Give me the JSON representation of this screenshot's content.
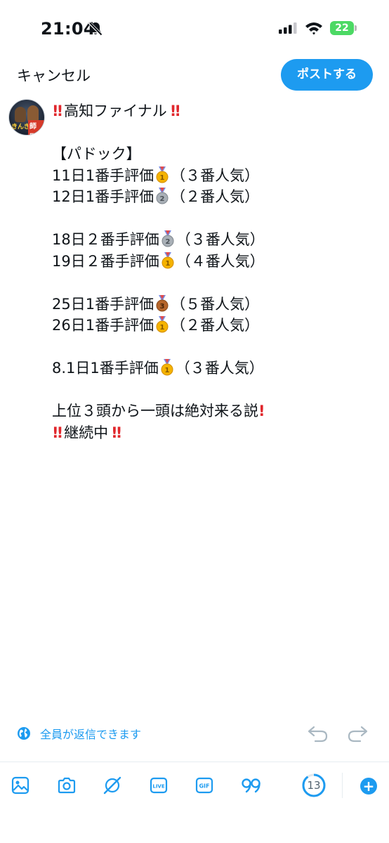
{
  "status_bar": {
    "time": "21:04",
    "battery": "22"
  },
  "header": {
    "cancel_label": "キャンセル",
    "post_label": "ポストする"
  },
  "avatar": {
    "text_left": "きんぎょ",
    "text_right": "師匠"
  },
  "tweet": {
    "title": "高知ファイナル",
    "section": "【パドック】",
    "entries": [
      {
        "date": "11日1番手評価",
        "medal": "gold",
        "note": "（３番人気）"
      },
      {
        "date": "12日1番手評価",
        "medal": "silver",
        "note": "（２番人気）"
      },
      {
        "date": "18日２番手評価",
        "medal": "silver",
        "note": "（３番人気）"
      },
      {
        "date": "19日２番手評価",
        "medal": "gold",
        "note": "（４番人気）"
      },
      {
        "date": "25日1番手評価",
        "medal": "bronze",
        "note": "（５番人気）"
      },
      {
        "date": "26日1番手評価",
        "medal": "gold",
        "note": "（２番人気）"
      },
      {
        "date": "8.1日1番手評価",
        "medal": "gold",
        "note": "（３番人気）"
      }
    ],
    "theory": "上位３頭から一頭は絶対来る説",
    "continuing": "継続中"
  },
  "reply_setting": {
    "label": "全員が返信できます"
  },
  "toolbar": {
    "char_count": "13"
  },
  "colors": {
    "accent": "#1d9bf0",
    "exclamation": "#e0262b",
    "gold": "#f5b300",
    "silver": "#a9b0b7",
    "bronze": "#b5652b"
  },
  "icons": [
    "bell-slash-icon",
    "signal-icon",
    "wifi-icon",
    "globe-icon",
    "undo-icon",
    "redo-icon",
    "image-icon",
    "camera-icon",
    "grok-icon",
    "live-icon",
    "gif-icon",
    "quote-icon",
    "plus-icon"
  ]
}
